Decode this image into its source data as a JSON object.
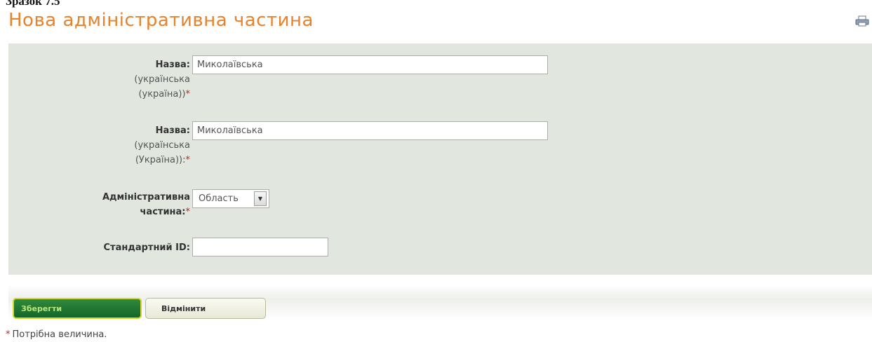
{
  "caption": "Зразок 7.5",
  "page_title": "Нова адміністративна частина",
  "icons": {
    "print": "printer-icon"
  },
  "form": {
    "name1": {
      "label": "Назва:",
      "sub_line1": "(українська",
      "sub_line2": "(україна))",
      "required_mark": "*",
      "value": "Миколаївська"
    },
    "name2": {
      "label": "Назва:",
      "sub_line1": "(українська",
      "sub_line2": "(Україна)):",
      "required_mark": "*",
      "value": "Миколаївська"
    },
    "admin_part": {
      "label_line1": "Адміністративна",
      "label_line2": "частина:",
      "required_mark": "*",
      "selected": "Область"
    },
    "standard_id": {
      "label": "Стандартний ID:",
      "value": ""
    }
  },
  "buttons": {
    "save": "Зберегти",
    "cancel": "Відмінити"
  },
  "footnote": {
    "mark": "*",
    "text": "Потрібна величина."
  },
  "colors": {
    "title": "#e8822c",
    "panel": "#e1e6df",
    "save_button": "#1f7a30",
    "save_border": "#d4d62a",
    "required": "#cc2222"
  }
}
